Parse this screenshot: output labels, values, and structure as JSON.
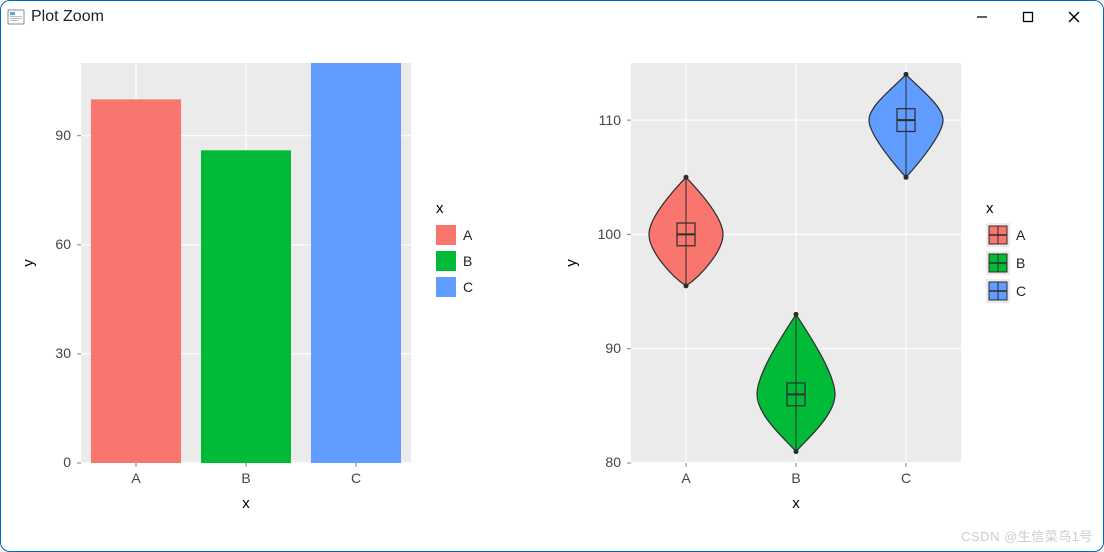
{
  "window": {
    "title": "Plot Zoom"
  },
  "watermark": "CSDN @生信菜鸟1号",
  "colors": {
    "A": "#f8766d",
    "B": "#00ba38",
    "C": "#619cff",
    "panel_bg": "#ebebeb",
    "grid_major": "#ffffff",
    "axis_text": "#444444"
  },
  "chart_data": [
    {
      "type": "bar",
      "categories": [
        "A",
        "B",
        "C"
      ],
      "values": [
        100,
        86,
        110
      ],
      "series_name": "x",
      "xlabel": "x",
      "ylabel": "y",
      "ylim": [
        0,
        110
      ],
      "y_ticks": [
        0,
        30,
        60,
        90
      ],
      "legend": {
        "title": "x",
        "entries": [
          "A",
          "B",
          "C"
        ]
      }
    },
    {
      "type": "violin+box",
      "categories": [
        "A",
        "B",
        "C"
      ],
      "xlabel": "x",
      "ylabel": "y",
      "ylim": [
        80,
        115
      ],
      "y_ticks": [
        80,
        90,
        100,
        110
      ],
      "series": [
        {
          "name": "A",
          "median": 100,
          "q1": 99,
          "q3": 101,
          "min": 95.5,
          "max": 105
        },
        {
          "name": "B",
          "median": 86,
          "q1": 85,
          "q3": 87,
          "min": 81,
          "max": 93
        },
        {
          "name": "C",
          "median": 110,
          "q1": 109,
          "q3": 111,
          "min": 105,
          "max": 114
        }
      ],
      "legend": {
        "title": "x",
        "entries": [
          "A",
          "B",
          "C"
        ]
      }
    }
  ]
}
